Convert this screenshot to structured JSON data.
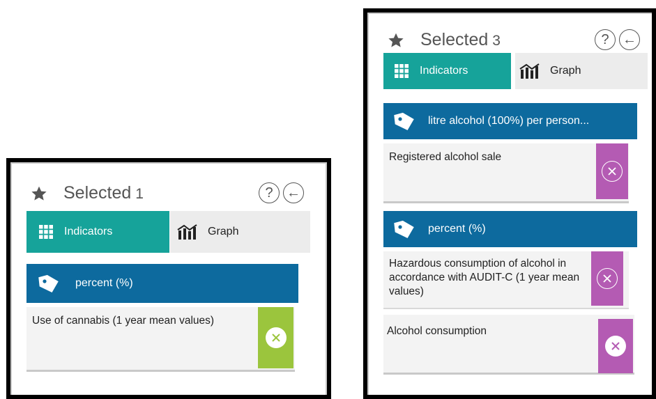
{
  "panel_left": {
    "title": "Selected",
    "count": "1",
    "help_symbol": "?",
    "back_symbol": "←",
    "tabs": {
      "indicators_label": "Indicators",
      "graph_label": "Graph"
    },
    "groups": [
      {
        "unit": "percent (%)",
        "items": [
          {
            "label": "Use of cannabis (1 year mean values)",
            "remove_color": "#9bc53d"
          }
        ]
      }
    ]
  },
  "panel_right": {
    "title": "Selected",
    "count": "3",
    "help_symbol": "?",
    "back_symbol": "←",
    "tabs": {
      "indicators_label": "Indicators",
      "graph_label": "Graph"
    },
    "groups": [
      {
        "unit": "litre alcohol (100%) per person...",
        "items": [
          {
            "label": "Registered alcohol sale",
            "remove_color": "#b45bb3"
          }
        ]
      },
      {
        "unit": "percent (%)",
        "items": [
          {
            "label": "Hazardous consumption of alcohol in accordance with AUDIT-C (1 year mean values)",
            "remove_color": "#b45bb3"
          },
          {
            "label": "Alcohol consumption",
            "remove_color": "#b45bb3"
          }
        ]
      }
    ]
  },
  "icons": {
    "favorite": "star-icon",
    "help": "help-circle-icon",
    "back": "back-arrow-icon",
    "indicators": "grid-icon",
    "graph": "bar-chart-icon",
    "unit": "tag-icon",
    "remove": "remove-x-icon"
  },
  "colors": {
    "teal_tab": "#16a39a",
    "blue_header": "#0d6a9e",
    "graph_tab": "#ececec",
    "item_bg": "#f3f3f3"
  }
}
